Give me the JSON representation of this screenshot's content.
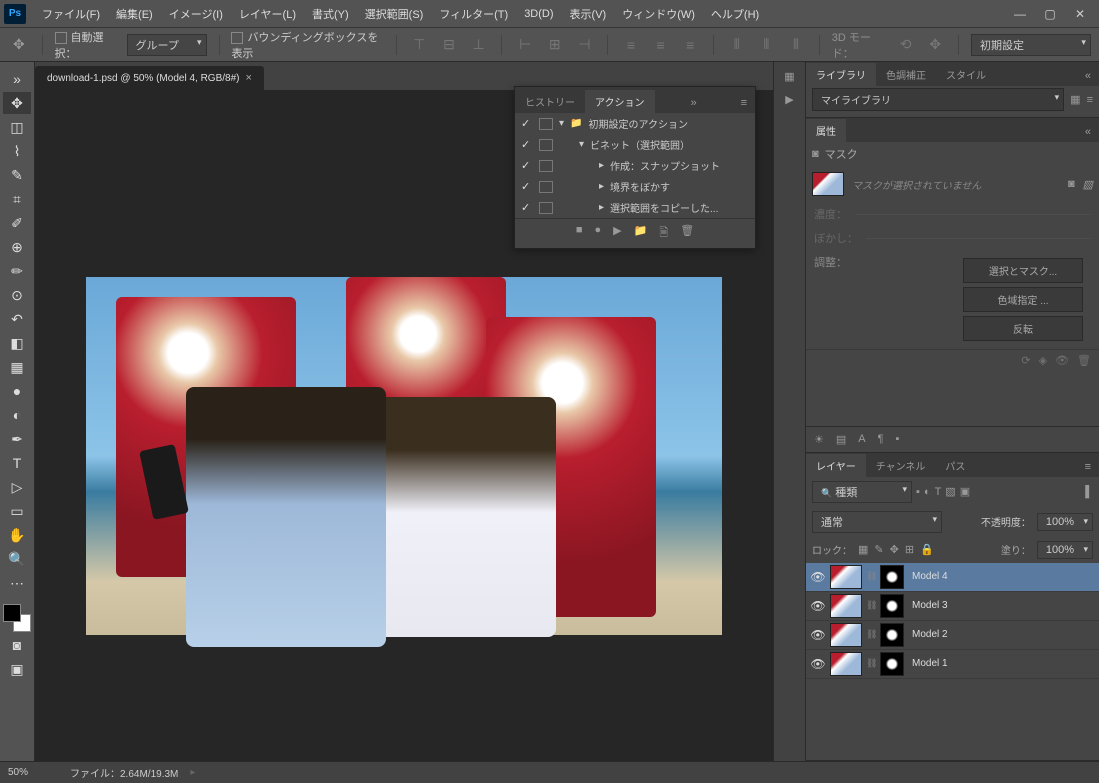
{
  "app": {
    "logo": "Ps"
  },
  "menu": [
    "ファイル(F)",
    "編集(E)",
    "イメージ(I)",
    "レイヤー(L)",
    "書式(Y)",
    "選択範囲(S)",
    "フィルター(T)",
    "3D(D)",
    "表示(V)",
    "ウィンドウ(W)",
    "ヘルプ(H)"
  ],
  "options": {
    "auto_select": "自動選択：",
    "group": "グループ",
    "bounding": "バウンディングボックスを表示",
    "mode3d": "3D モード：",
    "preset": "初期設定"
  },
  "doc": {
    "tab": "download-1.psd @ 50% (Model 4, RGB/8#)"
  },
  "actions": {
    "tab_history": "ヒストリー",
    "tab_actions": "アクション",
    "rows": [
      {
        "text": "初期設定のアクション",
        "indent": 0,
        "folder": true
      },
      {
        "text": "ビネット（選択範囲）",
        "indent": 1
      },
      {
        "text": "作成：スナップショット",
        "indent": 2
      },
      {
        "text": "境界をぼかす",
        "indent": 2
      },
      {
        "text": "選択範囲をコピーした...",
        "indent": 2
      }
    ]
  },
  "library": {
    "tab_lib": "ライブラリ",
    "tab_adjust": "色調補正",
    "tab_style": "スタイル",
    "select": "マイライブラリ"
  },
  "props": {
    "tab": "属性",
    "mask": "マスク",
    "msg": "マスクが選択されていません",
    "density": "濃度：",
    "feather": "ぼかし：",
    "adjust": "調整：",
    "btn_selmask": "選択とマスク...",
    "btn_colorrange": "色域指定 ...",
    "btn_invert": "反転"
  },
  "layers": {
    "tab_layers": "レイヤー",
    "tab_channels": "チャンネル",
    "tab_paths": "パス",
    "filter": "種類",
    "blend": "通常",
    "opacity_label": "不透明度：",
    "opacity_value": "100%",
    "lock_label": "ロック：",
    "fill_label": "塗り：",
    "fill_value": "100%",
    "items": [
      {
        "name": "Model 4",
        "selected": true
      },
      {
        "name": "Model 3",
        "selected": false
      },
      {
        "name": "Model 2",
        "selected": false
      },
      {
        "name": "Model 1",
        "selected": false
      }
    ]
  },
  "status": {
    "zoom": "50%",
    "doc": "ファイル：2.64M/19.3M"
  }
}
